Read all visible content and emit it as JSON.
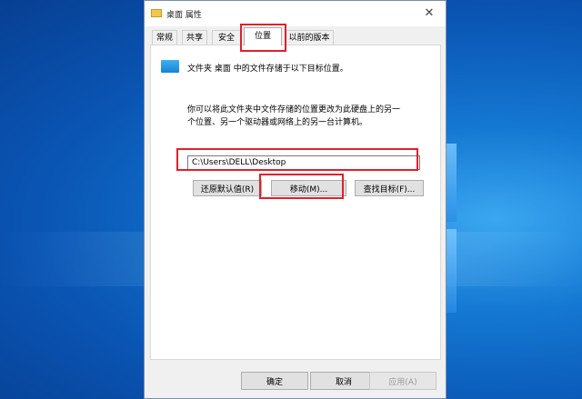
{
  "dialog": {
    "title": "桌面 属性",
    "close_glyph": "✕"
  },
  "tabs": [
    {
      "label": "常规"
    },
    {
      "label": "共享"
    },
    {
      "label": "安全"
    },
    {
      "label": "位置",
      "active": true
    },
    {
      "label": "以前的版本"
    }
  ],
  "location": {
    "description": "文件夹 桌面 中的文件存储于以下目标位置。",
    "info": "你可以将此文件夹中文件存储的位置更改为此硬盘上的另一个位置、另一个驱动器或网络上的另一台计算机。",
    "path": "C:\\Users\\DELL\\Desktop",
    "restore_label": "还原默认值(R)",
    "move_label": "移动(M)...",
    "find_label": "查找目标(F)..."
  },
  "footer": {
    "ok_label": "确定",
    "cancel_label": "取消",
    "apply_label": "应用(A)"
  },
  "colors": {
    "highlight": "#e0202a",
    "desktop_blue": "#0a55b4"
  }
}
